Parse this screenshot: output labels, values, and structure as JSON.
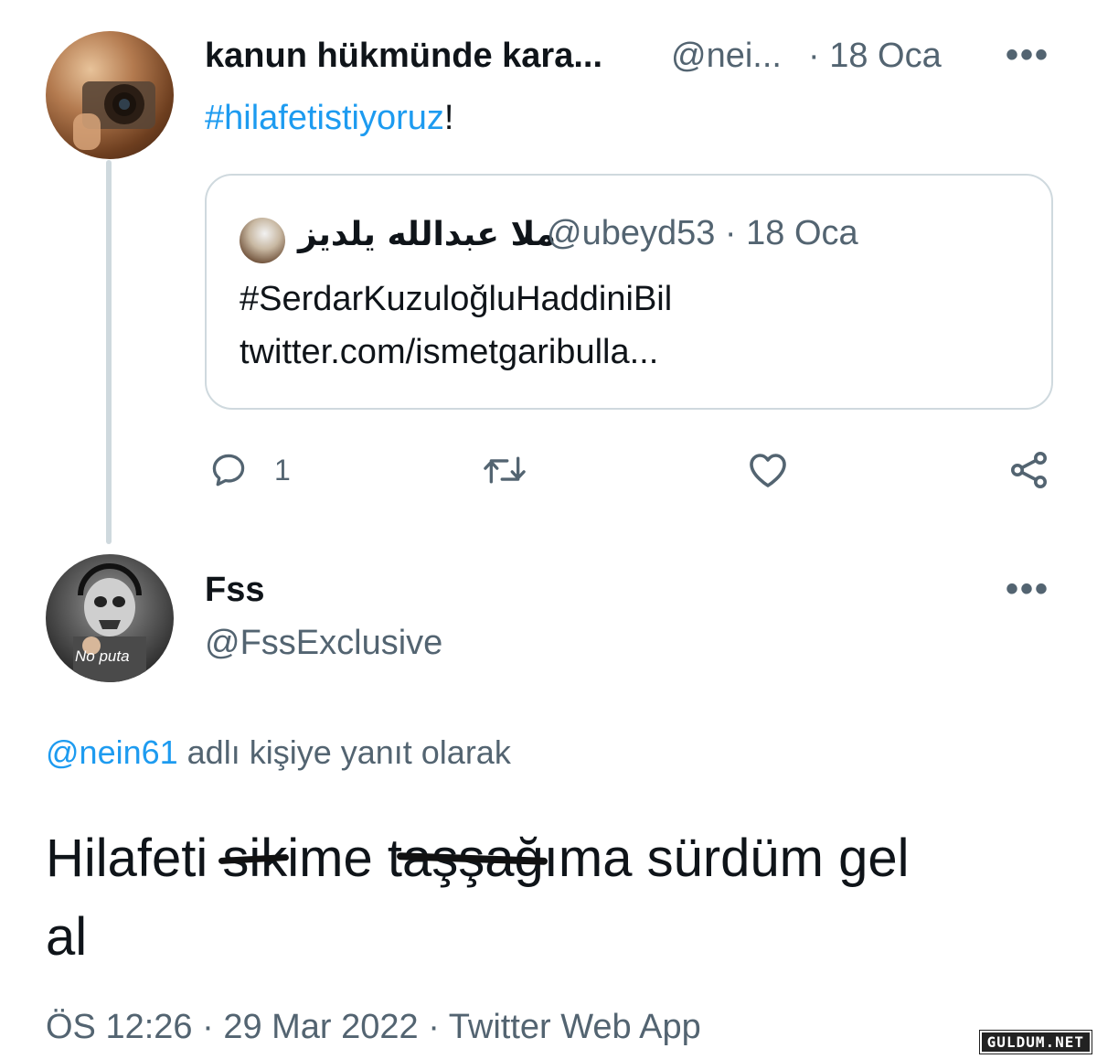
{
  "quoted_tweet_parent": {
    "author_name": "kanun hükmünde kara...",
    "handle": "@nei...",
    "date": "· 18 Oca",
    "hashtag": "#hilafetistiyoruz",
    "text_suffix": "!",
    "more_icon": "more-dots-icon",
    "quote": {
      "author_name": "ملا عبدالله يلديز",
      "handle_date": "@ubeyd53 · 18 Oca",
      "line1": "#SerdarKuzuloğluHaddiniBil",
      "line2": "twitter.com/ismetgaribulla..."
    },
    "actions": {
      "reply_count": "1",
      "icons": [
        "reply-icon",
        "retweet-icon",
        "like-icon",
        "share-icon"
      ]
    }
  },
  "reply_tweet": {
    "author_name": "Fss",
    "handle": "@FssExclusive",
    "avatar_caption": "No puta",
    "reply_to_handle": "@nein61",
    "reply_to_suffix": " adlı kişiye yanıt olarak",
    "body_line1_a": "Hilafeti ",
    "body_censored1_struck": "sik",
    "body_censored1_rest": "ime ",
    "body_censored2_lead": "t",
    "body_censored2_struck": "aşşağ",
    "body_censored2_rest": "ıma sürdüm gel",
    "body_line2": "al",
    "timestamp": "ÖS 12:26 · 29 Mar 2022 · Twitter Web App"
  },
  "watermark": "GULDUM.NET",
  "colors": {
    "link": "#1d9bf0",
    "muted": "#536471",
    "border": "#cfd9de",
    "text": "#0f1419"
  }
}
